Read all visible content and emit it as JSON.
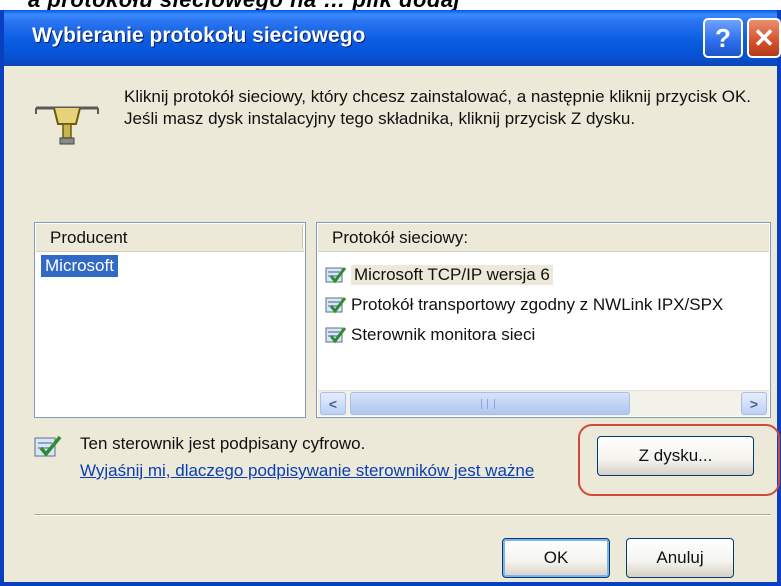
{
  "page_banner": {
    "clipped_text": "a protokołu sieciowego na … plik dodaj"
  },
  "dialog": {
    "title": "Wybieranie protokołu sieciowego",
    "help_label": "?",
    "close_label": "✕",
    "intro_text": "Kliknij protokół sieciowy, który chcesz zainstalować, a następnie kliknij przycisk OK. Jeśli masz dysk instalacyjny tego składnika, kliknij przycisk Z dysku."
  },
  "producer_list": {
    "header": "Producent",
    "items": [
      {
        "label": "Microsoft",
        "selected": true
      }
    ]
  },
  "protocol_list": {
    "header": "Protokół sieciowy:",
    "items": [
      {
        "label": "Microsoft TCP/IP wersja 6",
        "selected": true
      },
      {
        "label": "Protokół transportowy zgodny z NWLink IPX/SPX",
        "selected": false
      },
      {
        "label": "Sterownik monitora sieci",
        "selected": false
      }
    ],
    "scroll_left": "<",
    "scroll_right": ">"
  },
  "signature": {
    "text": "Ten sterownik jest podpisany cyfrowo.",
    "link": "Wyjaśnij mi, dlaczego podpisywanie sterowników jest ważne"
  },
  "buttons": {
    "have_disk": "Z dysku...",
    "ok": "OK",
    "cancel": "Anuluj"
  },
  "colors": {
    "titlebar": "#0A5CE0",
    "selection": "#316AC5",
    "annotation_ring": "#D04A3A",
    "link": "#0B3FB3"
  }
}
